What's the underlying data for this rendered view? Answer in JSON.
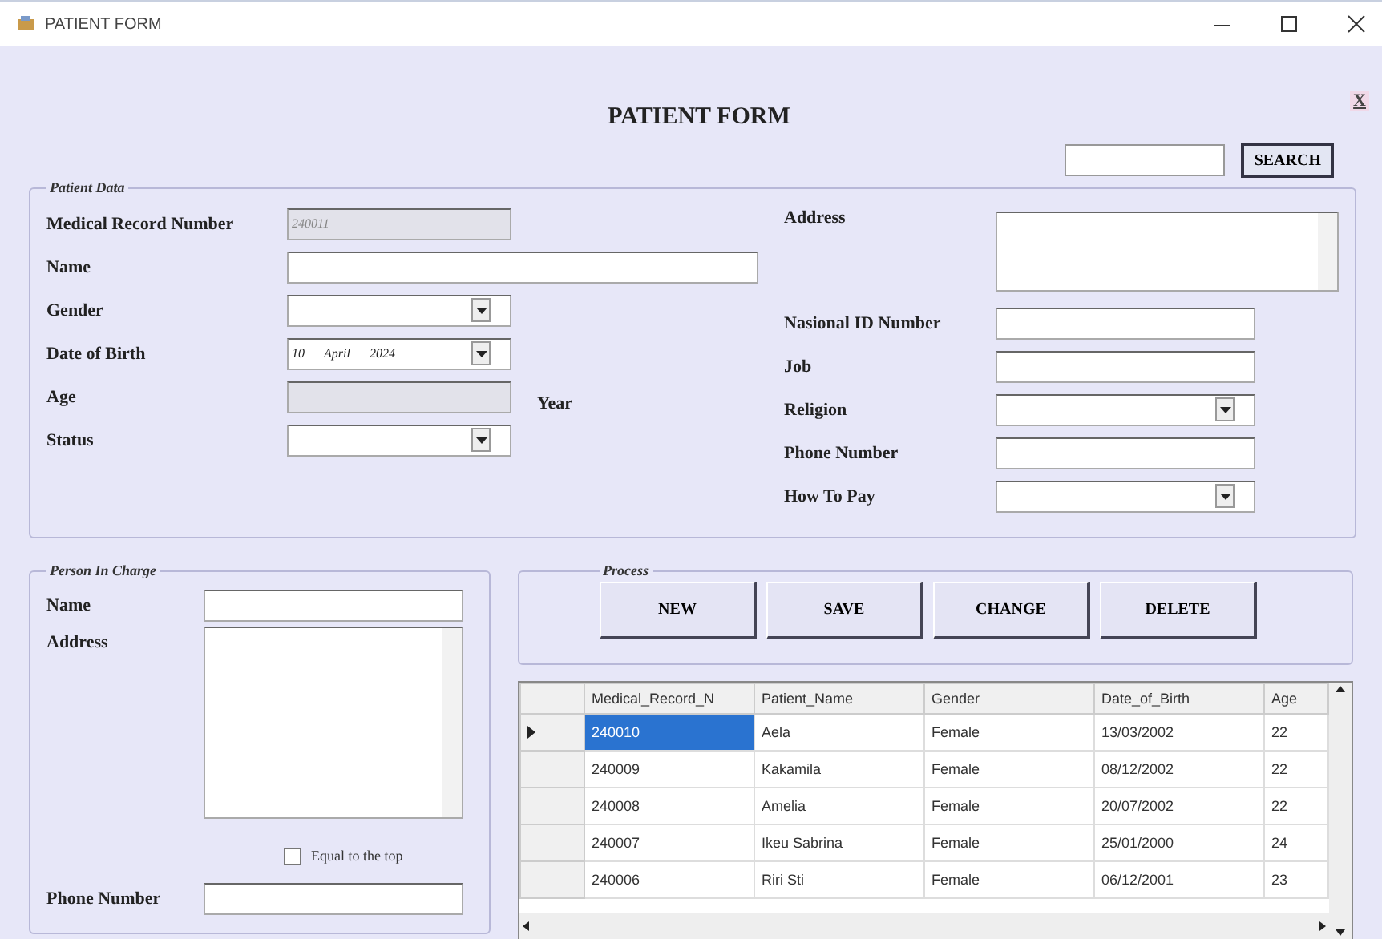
{
  "window": {
    "title": "PATIENT FORM"
  },
  "close_link": "X",
  "heading": "PATIENT FORM",
  "search": {
    "button": "SEARCH"
  },
  "patient_data": {
    "title": "Patient Data",
    "left_fields": [
      {
        "label": "Medical Record Number",
        "kind": "text",
        "value": "240011",
        "disabled": true
      },
      {
        "label": "Name",
        "kind": "wide",
        "disabled": false
      },
      {
        "label": "Gender",
        "kind": "dropdown"
      },
      {
        "label": "Date of Birth",
        "kind": "date",
        "day": "10",
        "month": "April",
        "year": "2024"
      },
      {
        "label": "Age",
        "kind": "text",
        "disabled": true,
        "suffix": "Year"
      },
      {
        "label": "Status",
        "kind": "dropdown"
      }
    ],
    "right_fields": [
      {
        "label": "Address",
        "kind": "textarea"
      },
      {
        "label": "Nasional ID Number",
        "kind": "text",
        "disabled": false
      },
      {
        "label": "Job",
        "kind": "text",
        "disabled": false
      },
      {
        "label": "Religion",
        "kind": "dropdown"
      },
      {
        "label": "Phone Number",
        "kind": "text",
        "disabled": false
      },
      {
        "label": "How To Pay",
        "kind": "dropdown"
      }
    ]
  },
  "person_in_charge": {
    "title": "Person In Charge",
    "name_label": "Name",
    "address_label": "Address",
    "checkbox": {
      "label": "Equal to the top",
      "checked": false
    },
    "phone_label": "Phone Number"
  },
  "process": {
    "title": "Process",
    "buttons": [
      "NEW",
      "SAVE",
      "CHANGE",
      "DELETE"
    ]
  },
  "table": {
    "columns": [
      "Medical_Record_N",
      "Patient_Name",
      "Gender",
      "Date_of_Birth",
      "Age"
    ],
    "rows": [
      {
        "cells": [
          "240010",
          "Aela",
          "Female",
          "13/03/2002",
          "22"
        ],
        "selected": true
      },
      {
        "cells": [
          "240009",
          "Kakamila",
          "Female",
          "08/12/2002",
          "22"
        ],
        "selected": false
      },
      {
        "cells": [
          "240008",
          "Amelia",
          "Female",
          "20/07/2002",
          "22"
        ],
        "selected": false
      },
      {
        "cells": [
          "240007",
          "Ikeu Sabrina",
          "Female",
          "25/01/2000",
          "24"
        ],
        "selected": false
      },
      {
        "cells": [
          "240006",
          "Riri Sti",
          "Female",
          "06/12/2001",
          "23"
        ],
        "selected": false
      }
    ]
  }
}
